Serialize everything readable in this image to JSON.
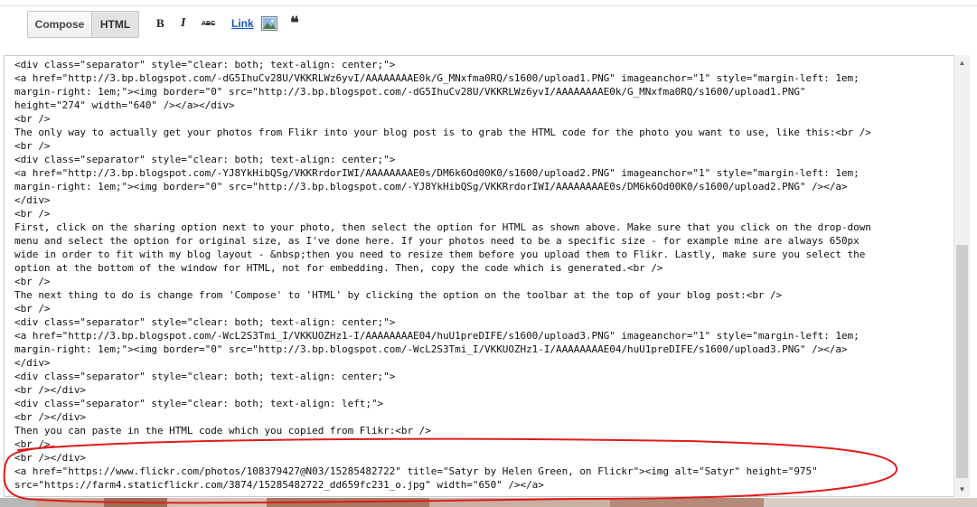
{
  "toolbar": {
    "compose_label": "Compose",
    "html_label": "HTML",
    "bold_label": "B",
    "italic_label": "I",
    "strike_label": "ABC",
    "link_label": "Link",
    "quote_label": "❝",
    "image_icon": "image-icon"
  },
  "editor": {
    "lines": [
      "<div class=\"separator\" style=\"clear: both; text-align: center;\">",
      "<a href=\"http://3.bp.blogspot.com/-dG5IhuCv28U/VKKRLWz6yvI/AAAAAAAAE0k/G_MNxfma0RQ/s1600/upload1.PNG\" imageanchor=\"1\" style=\"margin-left: 1em;",
      "margin-right: 1em;\"><img border=\"0\" src=\"http://3.bp.blogspot.com/-dG5IhuCv28U/VKKRLWz6yvI/AAAAAAAAE0k/G_MNxfma0RQ/s1600/upload1.PNG\"",
      "height=\"274\" width=\"640\" /></a></div>",
      "<br />",
      "The only way to actually get your photos from Flikr into your blog post is to grab the HTML code for the photo you want to use, like this:<br />",
      "<br />",
      "<div class=\"separator\" style=\"clear: both; text-align: center;\">",
      "<a href=\"http://3.bp.blogspot.com/-YJ8YkHibQSg/VKKRrdorIWI/AAAAAAAAE0s/DM6k6Od00K0/s1600/upload2.PNG\" imageanchor=\"1\" style=\"margin-left: 1em;",
      "margin-right: 1em;\"><img border=\"0\" src=\"http://3.bp.blogspot.com/-YJ8YkHibQSg/VKKRrdorIWI/AAAAAAAAE0s/DM6k6Od00K0/s1600/upload2.PNG\" /></a>",
      "</div>",
      "<br />",
      "First, click on the sharing option next to your photo, then select the option for HTML as shown above. Make sure that you click on the drop-down",
      "menu and select the option for original size, as I've done here. If your photos need to be a specific size - for example mine are always 650px",
      "wide in order to fit with my blog layout - &nbsp;then you need to resize them before you upload them to Flikr. Lastly, make sure you select the",
      "option at the bottom of the window for HTML, not for embedding. Then, copy the code which is generated.<br />",
      "<br />",
      "The next thing to do is change from 'Compose' to 'HTML' by clicking the option on the toolbar at the top of your blog post:<br />",
      "<br />",
      "<div class=\"separator\" style=\"clear: both; text-align: center;\">",
      "<a href=\"http://3.bp.blogspot.com/-WcL2S3Tmi_I/VKKUOZHz1-I/AAAAAAAAE04/huU1preDIFE/s1600/upload3.PNG\" imageanchor=\"1\" style=\"margin-left: 1em;",
      "margin-right: 1em;\"><img border=\"0\" src=\"http://3.bp.blogspot.com/-WcL2S3Tmi_I/VKKUOZHz1-I/AAAAAAAAE04/huU1preDIFE/s1600/upload3.PNG\" /></a>",
      "</div>",
      "<div class=\"separator\" style=\"clear: both; text-align: center;\">",
      "<br /></div>",
      "<div class=\"separator\" style=\"clear: both; text-align: left;\">",
      "<br /></div>",
      "Then you can paste in the HTML code which you copied from Flikr:<br />",
      "<br />",
      "<br /></div>",
      "<a href=\"https://www.flickr.com/photos/108379427@N03/15285482722\" title=\"Satyr by Helen Green, on Flickr\"><img alt=\"Satyr\" height=\"975\"",
      "src=\"https://farm4.staticflickr.com/3874/15285482722_dd659fc231_o.jpg\" width=\"650\" /></a>"
    ]
  },
  "annotation": {
    "color": "#e01b1b"
  },
  "colors": {
    "link": "#1155cc",
    "text": "#111111",
    "toolbar_border": "#c6c6c6"
  }
}
